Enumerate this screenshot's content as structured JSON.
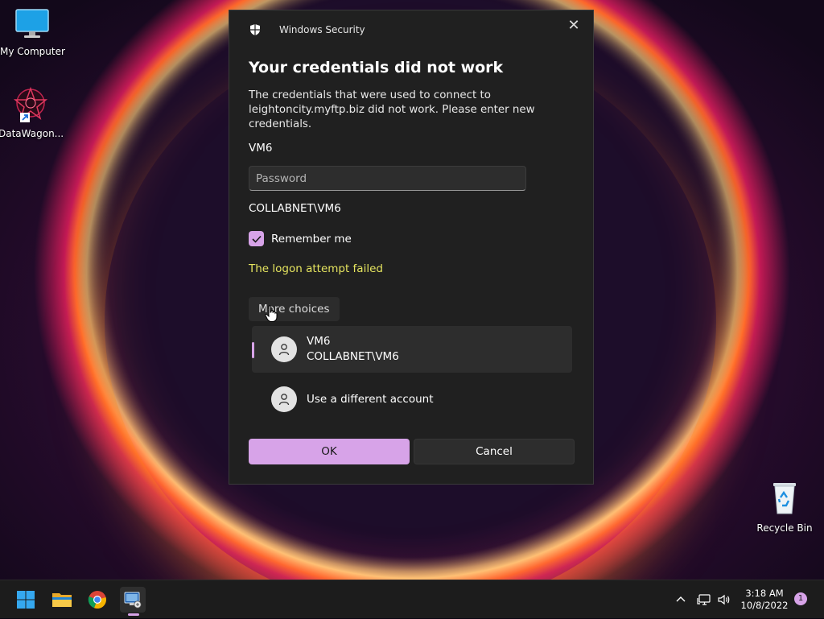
{
  "desktop": {
    "icons": [
      {
        "label": "My Computer"
      },
      {
        "label": "DataWagon..."
      },
      {
        "label": "Recycle Bin"
      }
    ]
  },
  "dialog": {
    "app_title": "Windows Security",
    "heading": "Your credentials did not work",
    "message": "The credentials that were used to connect to leightoncity.myftp.biz did not work. Please enter new credentials.",
    "username": "VM6",
    "password_placeholder": "Password",
    "domain_user": "COLLABNET\\VM6",
    "remember_label": "Remember me",
    "remember_checked": true,
    "error_text": "The logon attempt failed",
    "more_choices_label": "More choices",
    "accounts": [
      {
        "name": "VM6",
        "detail": "COLLABNET\\VM6",
        "selected": true
      },
      {
        "name": "Use a different account",
        "detail": "",
        "selected": false
      }
    ],
    "ok_label": "OK",
    "cancel_label": "Cancel"
  },
  "taskbar": {
    "apps": [
      "start-icon",
      "file-explorer-icon",
      "chrome-icon",
      "remote-desktop-icon"
    ],
    "time": "3:18 AM",
    "date": "10/8/2022",
    "notification_count": "1"
  },
  "colors": {
    "accent": "#d7a3e8",
    "error": "#e5e45f",
    "dialog_bg": "#202020"
  }
}
